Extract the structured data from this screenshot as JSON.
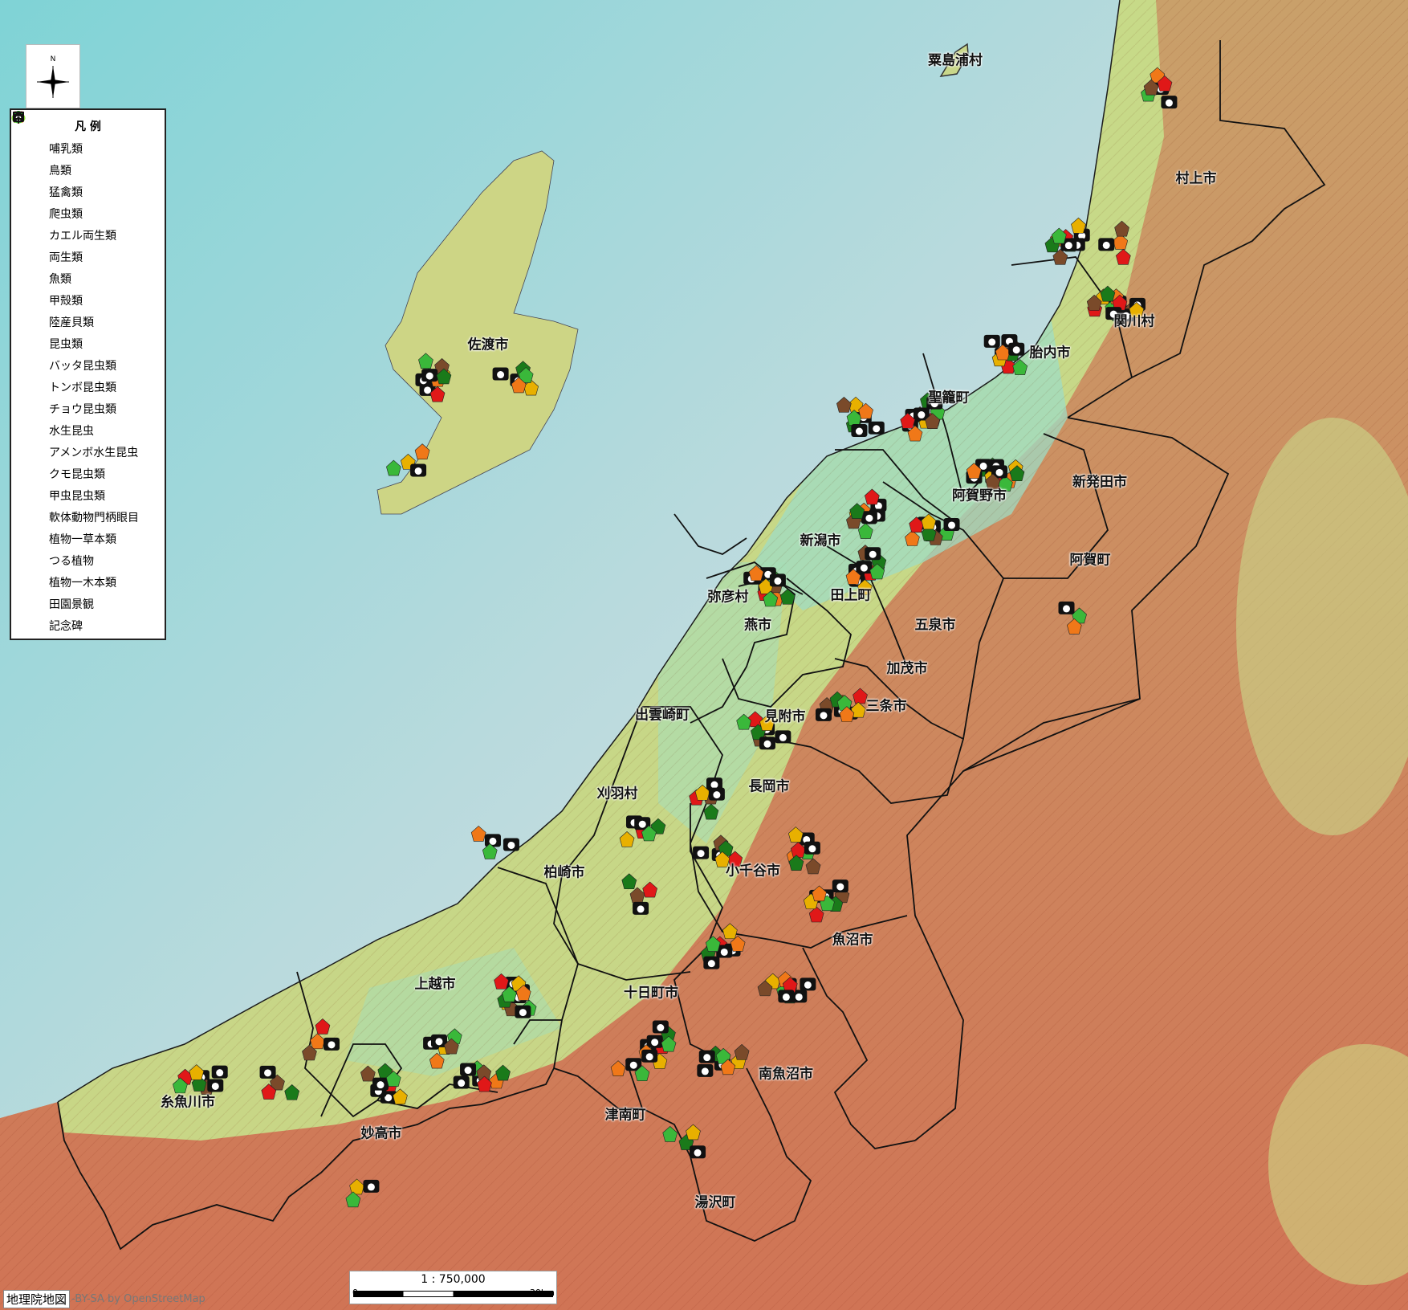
{
  "map": {
    "compass": {
      "n": "N"
    },
    "legend": {
      "title": "凡 例",
      "items": [
        {
          "label": "哺乳類",
          "icon": "mammal-icon",
          "color": "#8b1a1a"
        },
        {
          "label": "鳥類",
          "icon": "bird-icon",
          "color": "#7a4a2a"
        },
        {
          "label": "猛禽類",
          "icon": "raptor-icon",
          "color": "#e01818"
        },
        {
          "label": "爬虫類",
          "icon": "reptile-icon",
          "color": "#e8b000"
        },
        {
          "label": "カエル両生類",
          "icon": "frog-icon",
          "color": "#8bdc3c"
        },
        {
          "label": "両生類",
          "icon": "amphibian-icon",
          "color": "#3cc83c"
        },
        {
          "label": "魚類",
          "icon": "fish-icon",
          "color": "#9a8a1a"
        },
        {
          "label": "甲殻類",
          "icon": "crustacean-icon",
          "color": "#e02020"
        },
        {
          "label": "陸産貝類",
          "icon": "land-snail-icon",
          "color": "#a89070"
        },
        {
          "label": "昆虫類",
          "icon": "insect-icon",
          "color": "#2ec82e"
        },
        {
          "label": "バッタ昆虫類",
          "icon": "grasshopper-icon",
          "color": "#2e7a2e"
        },
        {
          "label": "トンボ昆虫類",
          "icon": "dragonfly-icon",
          "color": "#f07818"
        },
        {
          "label": "チョウ昆虫類",
          "icon": "butterfly-icon",
          "color": "#8a2aa0"
        },
        {
          "label": "水生昆虫",
          "icon": "aquatic-insect-icon",
          "color": "#2a3ad8"
        },
        {
          "label": "アメンボ水生昆虫",
          "icon": "water-strider-icon",
          "color": "#1a5ad8"
        },
        {
          "label": "クモ昆虫類",
          "icon": "spider-icon",
          "color": "#f0e020"
        },
        {
          "label": "甲虫昆虫類",
          "icon": "beetle-icon",
          "color": "#1a4a1a"
        },
        {
          "label": "軟体動物門柄眼目",
          "icon": "slug-icon",
          "color": "#7ac83c"
        },
        {
          "label": "植物一草本類",
          "icon": "herb-plant-icon",
          "color": "#3ab83a"
        },
        {
          "label": "つる植物",
          "icon": "vine-plant-icon",
          "color": "#1a8a1a"
        },
        {
          "label": "植物一木本類",
          "icon": "tree-icon",
          "color": "#1a7a1a"
        },
        {
          "label": "田園景観",
          "icon": "camera-icon",
          "color": "#111111"
        },
        {
          "label": "記念碑",
          "icon": "monument-icon",
          "color": "#111111"
        }
      ]
    },
    "places": [
      "粟島浦村",
      "村上市",
      "佐渡市",
      "胎内市",
      "関川村",
      "聖籠町",
      "新発田市",
      "阿賀野市",
      "新潟市",
      "阿賀町",
      "弥彦村",
      "燕市",
      "五泉市",
      "田上町",
      "加茂市",
      "出雲崎町",
      "見附市",
      "三条市",
      "刈羽村",
      "長岡市",
      "柏崎市",
      "小千谷市",
      "魚沼市",
      "上越市",
      "十日町市",
      "南魚沼市",
      "糸魚川市",
      "妙高市",
      "津南町",
      "湯沢町"
    ],
    "scale": {
      "ratio": "1 : 750,000",
      "left": "0",
      "right": "30km"
    },
    "attribution": {
      "source": "地理院地図",
      "license": "-BY-SA by OpenStreetMap"
    }
  }
}
